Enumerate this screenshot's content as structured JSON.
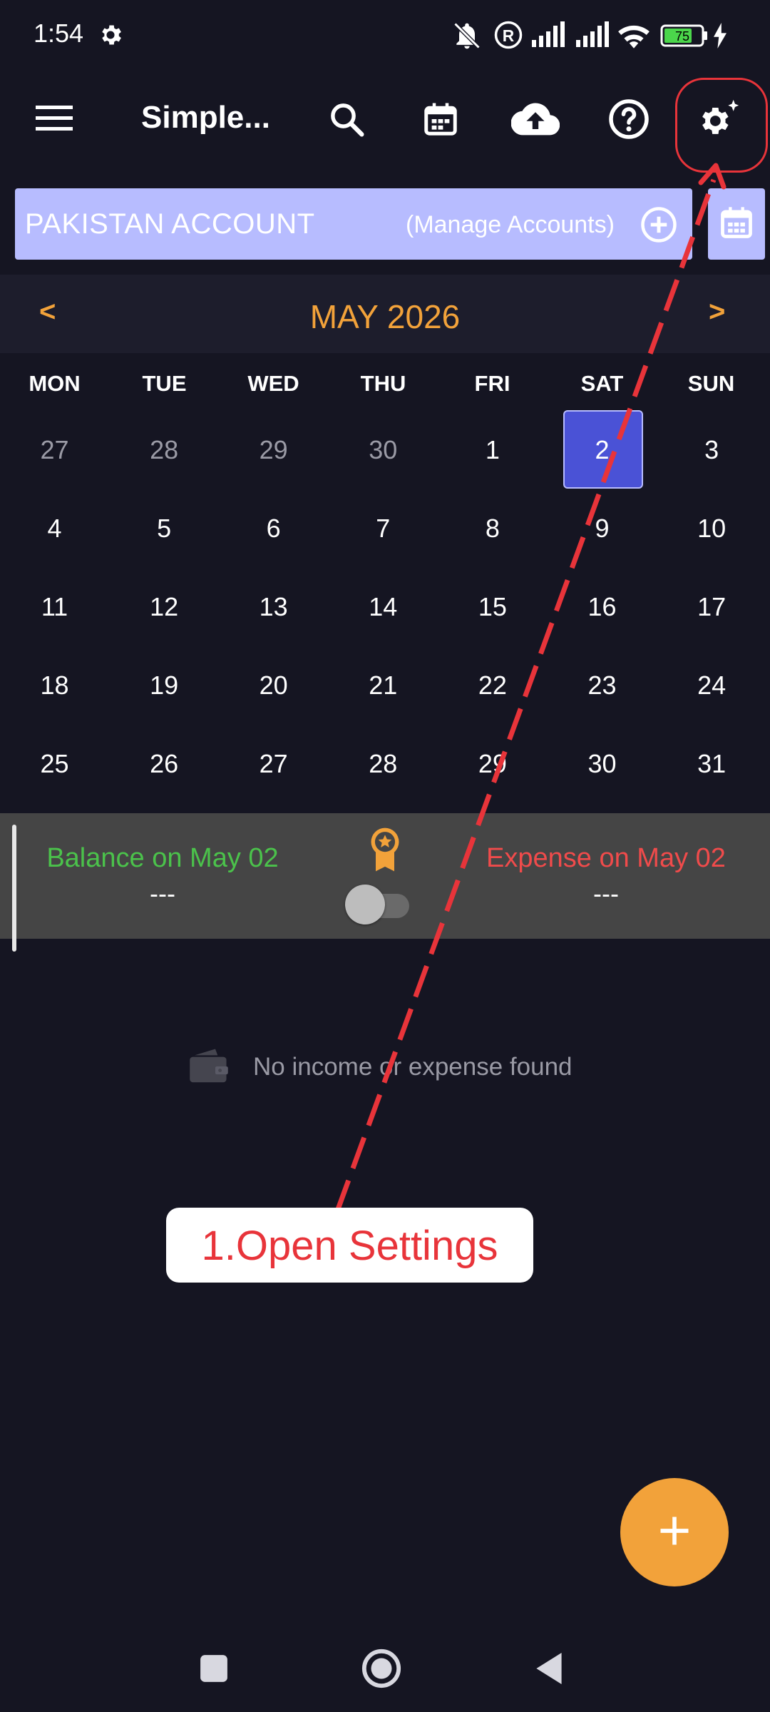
{
  "status_bar": {
    "time": "1:54",
    "battery": "75",
    "icons": [
      "settings-gear-icon",
      "mute-icon",
      "registered-icon",
      "signal-icon",
      "signal-icon",
      "wifi-icon",
      "battery-icon",
      "charging-icon"
    ]
  },
  "toolbar": {
    "title": "Simple...",
    "icons": [
      "menu-icon",
      "search-icon",
      "calendar-icon",
      "cloud-upload-icon",
      "help-icon",
      "settings-icon"
    ]
  },
  "account": {
    "name": "PAKISTAN ACCOUNT",
    "manage_label": "(Manage Accounts)"
  },
  "month_nav": {
    "prev": "<",
    "title": "MAY 2026",
    "next": ">"
  },
  "calendar": {
    "weekdays": [
      "MON",
      "TUE",
      "WED",
      "THU",
      "FRI",
      "SAT",
      "SUN"
    ],
    "weeks": [
      [
        "27",
        "28",
        "29",
        "30",
        "1",
        "2",
        "3"
      ],
      [
        "4",
        "5",
        "6",
        "7",
        "8",
        "9",
        "10"
      ],
      [
        "11",
        "12",
        "13",
        "14",
        "15",
        "16",
        "17"
      ],
      [
        "18",
        "19",
        "20",
        "21",
        "22",
        "23",
        "24"
      ],
      [
        "25",
        "26",
        "27",
        "28",
        "29",
        "30",
        "31"
      ]
    ],
    "muted_first_row_count": 4,
    "selected_day": "2"
  },
  "summary": {
    "balance_label": "Balance on May 02",
    "balance_value": "---",
    "expense_label": "Expense on May 02",
    "expense_value": "---"
  },
  "empty_state": {
    "text": "No income or expense found"
  },
  "annotation": {
    "text": "1.Open Settings",
    "color": "#e8343a"
  },
  "colors": {
    "background": "#151522",
    "accent": "#f2a23a",
    "account_bar": "#b7bcff",
    "selected_day": "#4a52d6",
    "balance_green": "#4bc24b",
    "expense_red": "#f04b4b"
  }
}
